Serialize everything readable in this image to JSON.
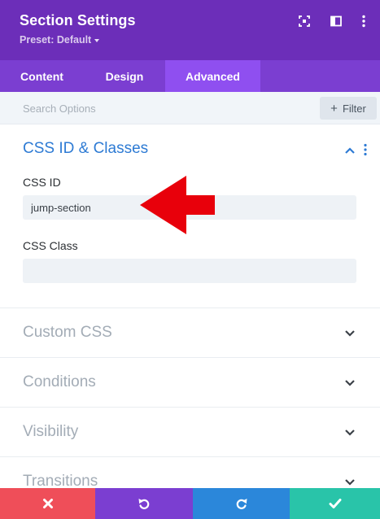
{
  "header": {
    "title": "Section Settings",
    "preset_label": "Preset: Default",
    "background": "#6c2eb9",
    "icons": [
      "expand-icon",
      "sidebar-toggle-icon",
      "more-vertical-icon"
    ]
  },
  "tabs": [
    {
      "label": "Content",
      "active": false
    },
    {
      "label": "Design",
      "active": false
    },
    {
      "label": "Advanced",
      "active": true
    }
  ],
  "search": {
    "placeholder": "Search Options",
    "value": "",
    "filter_label": "Filter"
  },
  "groups": {
    "open": {
      "title": "CSS ID & Classes",
      "fields": [
        {
          "label": "CSS ID",
          "value": "jump-section",
          "placeholder": ""
        },
        {
          "label": "CSS Class",
          "value": "",
          "placeholder": ""
        }
      ]
    },
    "closed": [
      {
        "title": "Custom CSS"
      },
      {
        "title": "Conditions"
      },
      {
        "title": "Visibility"
      },
      {
        "title": "Transitions"
      }
    ]
  },
  "annotation": {
    "icon": "red-arrow-left-icon",
    "color": "#e8000b"
  },
  "bottom_bar": [
    {
      "name": "discard",
      "icon": "close-icon",
      "color": "#ef4e59"
    },
    {
      "name": "undo",
      "icon": "undo-icon",
      "color": "#7b3ed1"
    },
    {
      "name": "redo",
      "icon": "redo-icon",
      "color": "#2b87da"
    },
    {
      "name": "save",
      "icon": "check-icon",
      "color": "#29c4a9"
    }
  ],
  "colors": {
    "accent_blue": "#2e7bd4",
    "tab_bar": "#7b3ed1",
    "tab_active": "#8f4ff0"
  }
}
